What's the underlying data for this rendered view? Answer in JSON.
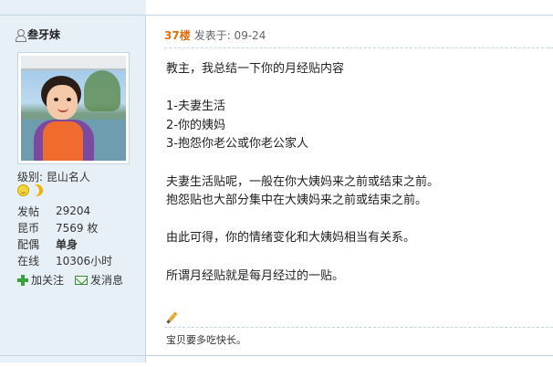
{
  "sidebar": {
    "username": "叁牙妹",
    "level_label": "级别:",
    "level_value": "昆山名人",
    "stats": [
      {
        "label": "发帖",
        "value": "29204",
        "bold": false
      },
      {
        "label": "昆币",
        "value": "7569 枚",
        "bold": false
      },
      {
        "label": "配偶",
        "value": "单身",
        "bold": true
      },
      {
        "label": "在线",
        "value": "10306小时",
        "bold": false
      }
    ],
    "follow_label": "加关注",
    "message_label": "发消息"
  },
  "post": {
    "floor": "37楼",
    "posted_at": "发表于: 09-24",
    "lines": [
      "教主，我总结一下你的月经贴内容",
      "",
      "1-夫妻生活",
      "2-你的姨妈",
      "3-抱怨你老公或你老公家人",
      "",
      "夫妻生活贴呢，一般在你大姨妈来之前或结束之前。",
      "抱怨贴也大部分集中在大姨妈来之前或结束之前。",
      "",
      "由此可得，你的情绪变化和大姨妈相当有关系。",
      "",
      "所谓月经贴就是每月经过的一贴。"
    ],
    "signature": "宝贝要多吃快长。"
  },
  "icons": {
    "user": "user-icon",
    "follow": "plus-icon",
    "message": "mail-icon",
    "signature": "pencil-icon"
  }
}
